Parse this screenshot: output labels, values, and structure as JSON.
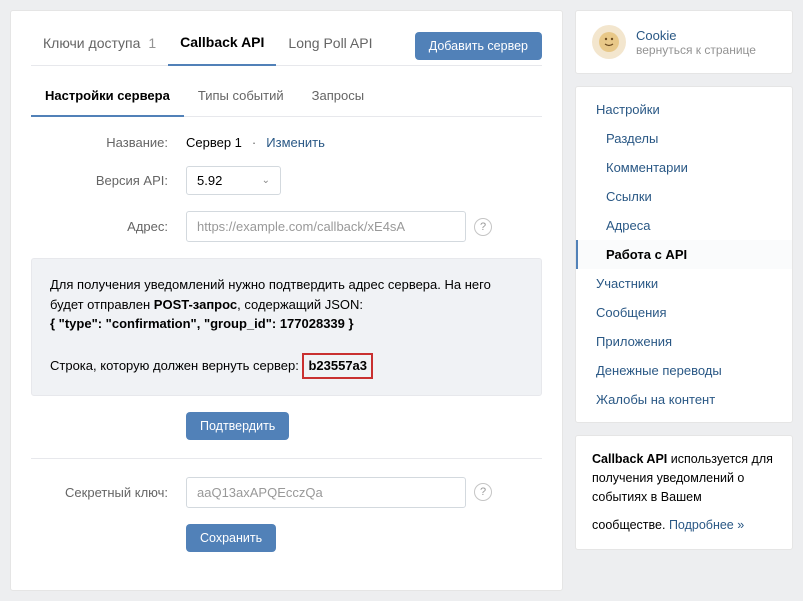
{
  "topTabs": {
    "keys": "Ключи доступа",
    "keysCount": "1",
    "callback": "Callback API",
    "longpoll": "Long Poll API"
  },
  "addServer": "Добавить сервер",
  "subTabs": {
    "server": "Настройки сервера",
    "events": "Типы событий",
    "requests": "Запросы"
  },
  "form": {
    "nameLabel": "Название:",
    "nameValue": "Сервер 1",
    "changeLink": "Изменить",
    "apiLabel": "Версия API:",
    "apiValue": "5.92",
    "addressLabel": "Адрес:",
    "addressPlaceholder": "https://example.com/callback/xE4sA",
    "secretLabel": "Секретный ключ:",
    "secretPlaceholder": "aaQ13axAPQEcczQa"
  },
  "info": {
    "line1a": "Для получения уведомлений нужно подтвердить адрес сервера. На него будет отправлен ",
    "postReq": "POST-запрос",
    "line1b": ", содержащий JSON:",
    "json": "{ \"type\": \"confirmation\", \"group_id\": 177028339 }",
    "line2": "Строка, которую должен вернуть сервер: ",
    "code": "b23557a3"
  },
  "buttons": {
    "confirm": "Подтвердить",
    "save": "Сохранить"
  },
  "cookie": {
    "name": "Cookie",
    "sub": "вернуться к странице"
  },
  "nav": {
    "settings": "Настройки",
    "sections": "Разделы",
    "comments": "Комментарии",
    "links": "Ссылки",
    "addresses": "Адреса",
    "api": "Работа с API",
    "members": "Участники",
    "messages": "Сообщения",
    "apps": "Приложения",
    "money": "Денежные переводы",
    "reports": "Жалобы на контент"
  },
  "infoCard": {
    "strong": "Callback API",
    "text": " используется для получения уведомлений о событиях в Вашем сообществе.",
    "more": "Подробнее »"
  }
}
